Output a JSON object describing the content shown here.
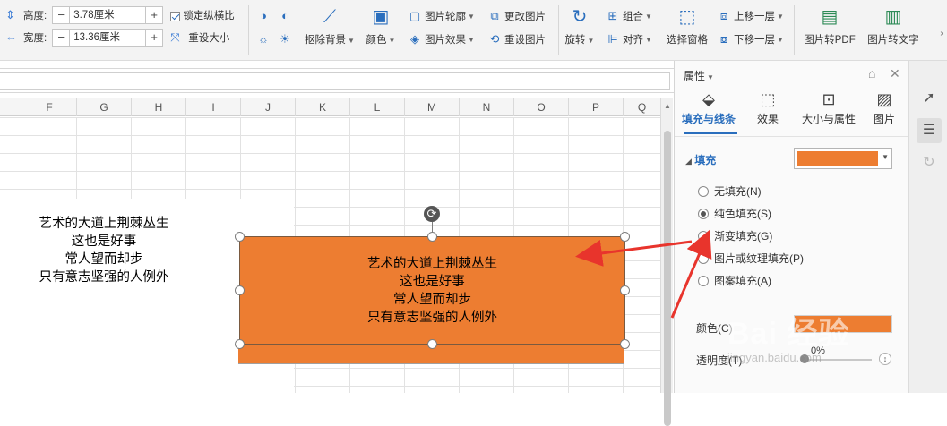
{
  "ribbon": {
    "height_label": "高度:",
    "height_value": "3.78厘米",
    "width_label": "宽度:",
    "width_value": "13.36厘米",
    "lock_ratio": "锁定纵横比",
    "reset_size": "重设大小",
    "remove_bg": "抠除背景",
    "color": "颜色",
    "outline": "图片轮廓",
    "effect": "图片效果",
    "change_pic": "更改图片",
    "reset_pic": "重设图片",
    "rotate": "旋转",
    "group": "组合",
    "align": "对齐",
    "selection_pane": "选择窗格",
    "bring_forward": "上移一层",
    "send_backward": "下移一层",
    "pic_to_pdf": "图片转PDF",
    "pic_to_text": "图片转文字"
  },
  "columns": [
    "F",
    "G",
    "H",
    "I",
    "J",
    "K",
    "L",
    "M",
    "N",
    "O",
    "P",
    "Q"
  ],
  "cell_text": [
    "艺术的大道上荆棘丛生",
    "这也是好事",
    "常人望而却步",
    "只有意志坚强的人例外"
  ],
  "shape": {
    "lines": [
      "艺术的大道上荆棘丛生",
      "这也是好事",
      "常人望而却步",
      "只有意志坚强的人例外"
    ],
    "fill_color": "#ed7d31"
  },
  "panel": {
    "title": "属性",
    "tabs": [
      "填充与线条",
      "效果",
      "大小与属性",
      "图片"
    ],
    "fill_section": "填充",
    "options": [
      "无填充(N)",
      "纯色填充(S)",
      "渐变填充(G)",
      "图片或纹理填充(P)",
      "图案填充(A)"
    ],
    "selected_option": "纯色填充(S)",
    "color_label": "颜色(C)",
    "opacity_label": "透明度(T)",
    "opacity_value": "0%",
    "fill_color": "#ed7d31"
  },
  "watermark": {
    "logo": "Bai 经验",
    "url": "jingyan.baidu.com"
  },
  "accent_color": "#2a6ebd"
}
